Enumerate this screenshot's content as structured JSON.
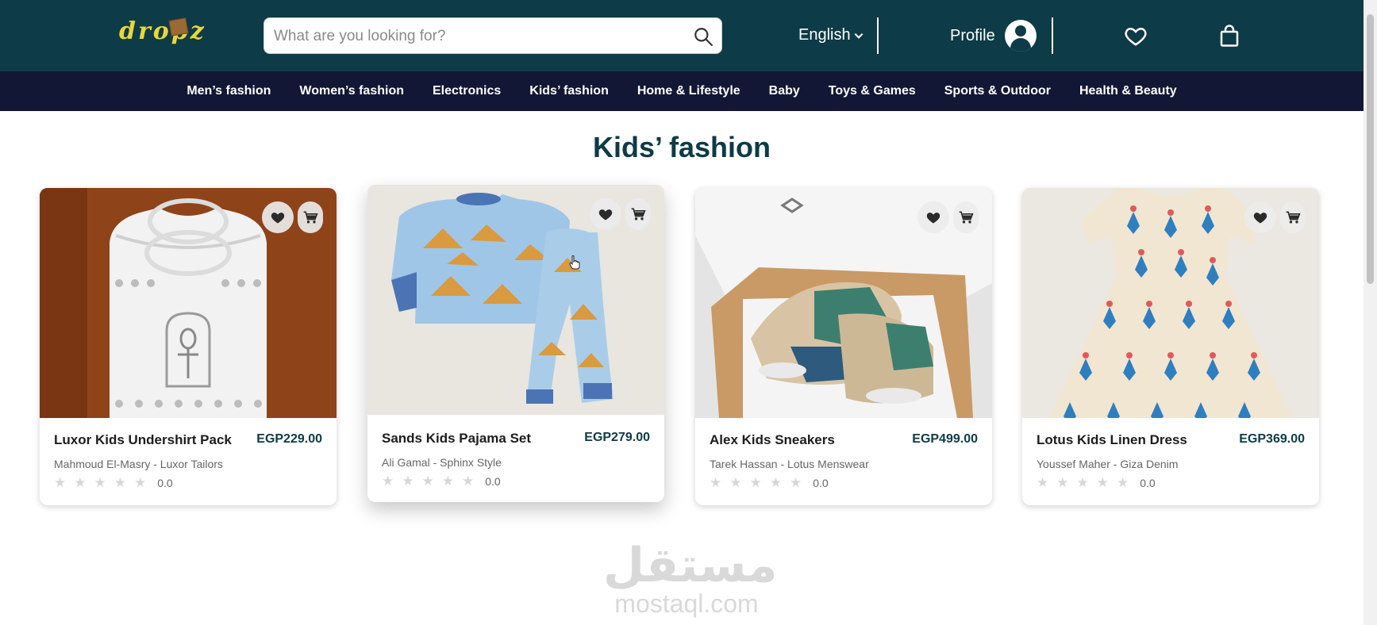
{
  "header": {
    "logo_text": "dropz",
    "search_placeholder": "What are you looking for?",
    "language": "English",
    "profile_label": "Profile",
    "icons": [
      "search-icon",
      "chevron-down-icon",
      "user-avatar-icon",
      "heart-icon",
      "shopping-bag-icon"
    ]
  },
  "categories": [
    "Men’s fashion",
    "Women’s fashion",
    "Electronics",
    "Kids’ fashion",
    "Home & Lifestyle",
    "Baby",
    "Toys & Games",
    "Sports & Outdoor",
    "Health & Beauty"
  ],
  "page": {
    "title": "Kids’ fashion"
  },
  "products": [
    {
      "name": "Luxor Kids Undershirt Pack",
      "price": "EGP229.00",
      "seller": "Mahmoud El-Masry - Luxor Tailors",
      "rating": "0.0"
    },
    {
      "name": "Sands Kids Pajama Set",
      "price": "EGP279.00",
      "seller": "Ali Gamal - Sphinx Style",
      "rating": "0.0"
    },
    {
      "name": "Alex Kids Sneakers",
      "price": "EGP499.00",
      "seller": "Tarek Hassan - Lotus Menswear",
      "rating": "0.0"
    },
    {
      "name": "Lotus Kids Linen Dress",
      "price": "EGP369.00",
      "seller": "Youssef Maher - Giza Denim",
      "rating": "0.0"
    }
  ],
  "watermark": {
    "arabic": "مستقل",
    "latin": "mostaql.com"
  },
  "colors": {
    "header_bg": "#0d3b47",
    "category_bg": "#121735",
    "accent": "#0d3b47",
    "logo": "#e8d63a"
  }
}
